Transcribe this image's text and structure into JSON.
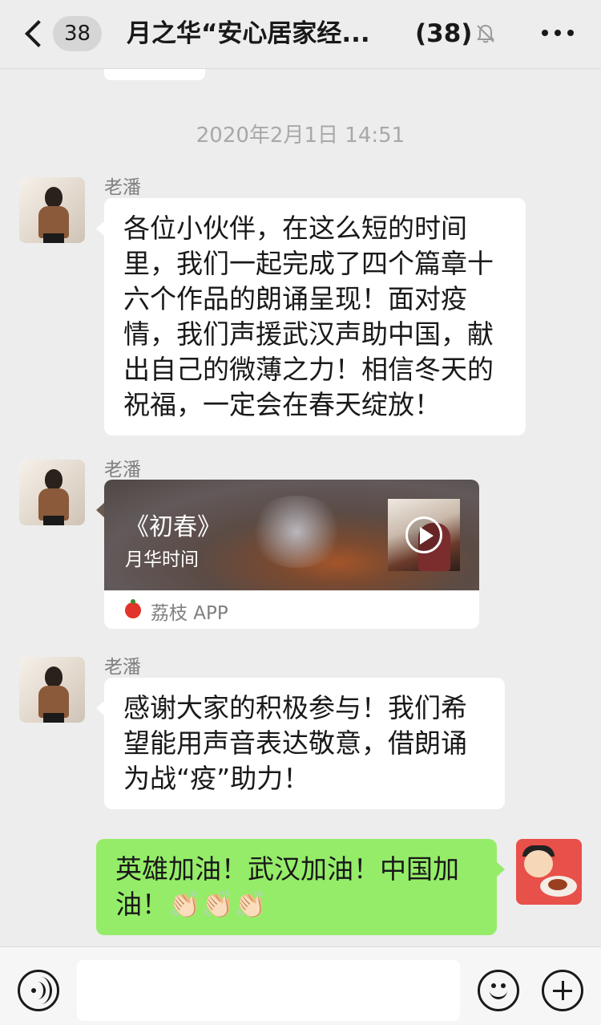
{
  "header": {
    "unread_badge": "38",
    "title": "月之华“安心居家经...",
    "member_count": "(38)"
  },
  "timestamp": "2020年2月1日 14:51",
  "messages": [
    {
      "sender": "老潘",
      "text": "各位小伙伴，在这么短的时间里，我们一起完成了四个篇章十六个作品的朗诵呈现！面对疫情，我们声援武汉声助中国，献出自己的微薄之力！相信冬天的祝福，一定会在春天绽放！"
    },
    {
      "sender": "老潘",
      "card": {
        "title": "《初春》",
        "subtitle": "月华时间",
        "app_name": "荔枝 APP"
      }
    },
    {
      "sender": "老潘",
      "text": "感谢大家的积极参与！我们希望能用声音表达敬意，借朗诵为战“疫”助力！"
    },
    {
      "sender": "me",
      "text": "英雄加油！武汉加油！中国加油！👏🏻👏🏻👏🏻"
    }
  ],
  "icons": {
    "back": "chevron-left-icon",
    "mute": "bell-muted-icon",
    "more": "more-dots-icon",
    "voice": "voice-input-icon",
    "emoji": "emoji-icon",
    "plus": "plus-icon"
  },
  "colors": {
    "background": "#ededed",
    "own_bubble": "#95ec69",
    "other_bubble": "#ffffff"
  }
}
